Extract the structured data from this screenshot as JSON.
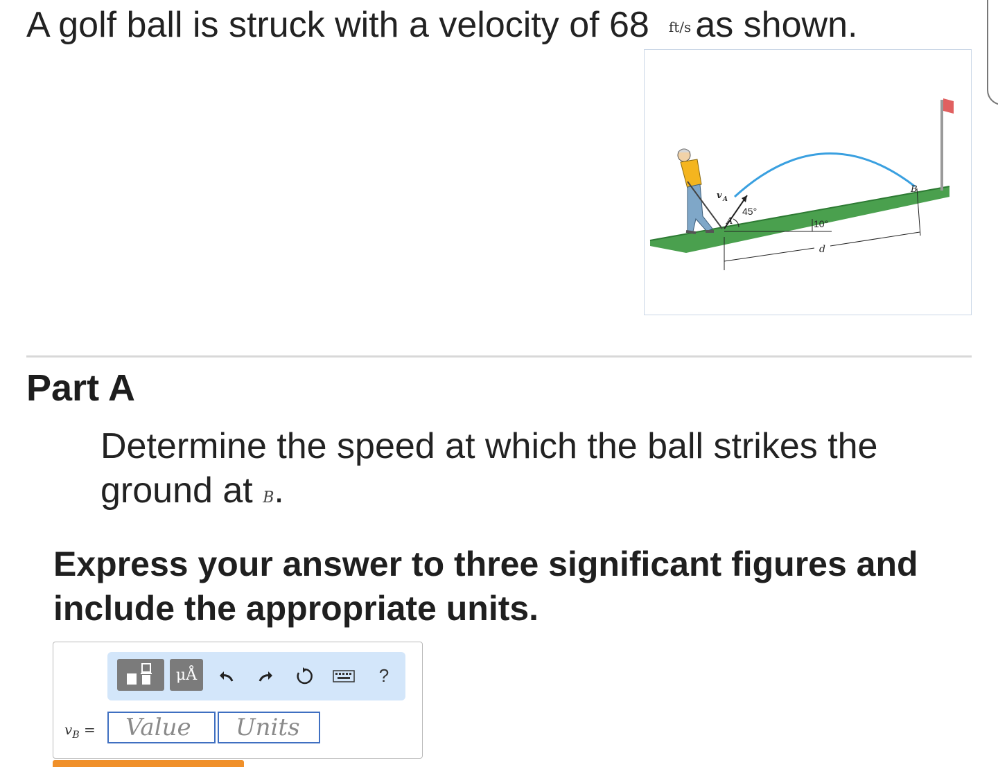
{
  "problem": {
    "text_before": "A golf ball is struck with a velocity of 68",
    "unit": "ft/s",
    "text_after": "as shown."
  },
  "figure": {
    "label_va": "v",
    "label_va_sub": "A",
    "label_a": "A",
    "label_angle_launch": "45°",
    "label_angle_slope": "10°",
    "label_b": "B",
    "label_d": "d",
    "colors": {
      "ground": "#4aa04e",
      "trajectory": "#3aa0e0",
      "flag": "#e06060",
      "pole": "#9a9a9a"
    }
  },
  "part": {
    "title": "Part A",
    "question_text": "Determine the speed at which the ball strikes the ground at",
    "question_var": "B",
    "question_end": ".",
    "instructions": "Express your answer to three significant figures and include the appropriate units."
  },
  "toolbar": {
    "templates_icon": "templates-icon",
    "units_label": "μÅ",
    "undo_icon": "undo-icon",
    "redo_icon": "redo-icon",
    "reset_icon": "reset-icon",
    "keyboard_icon": "keyboard-icon",
    "help_label": "?"
  },
  "answer": {
    "var": "v",
    "var_sub": "B",
    "equals": "=",
    "value_placeholder": "Value",
    "units_placeholder": "Units"
  }
}
